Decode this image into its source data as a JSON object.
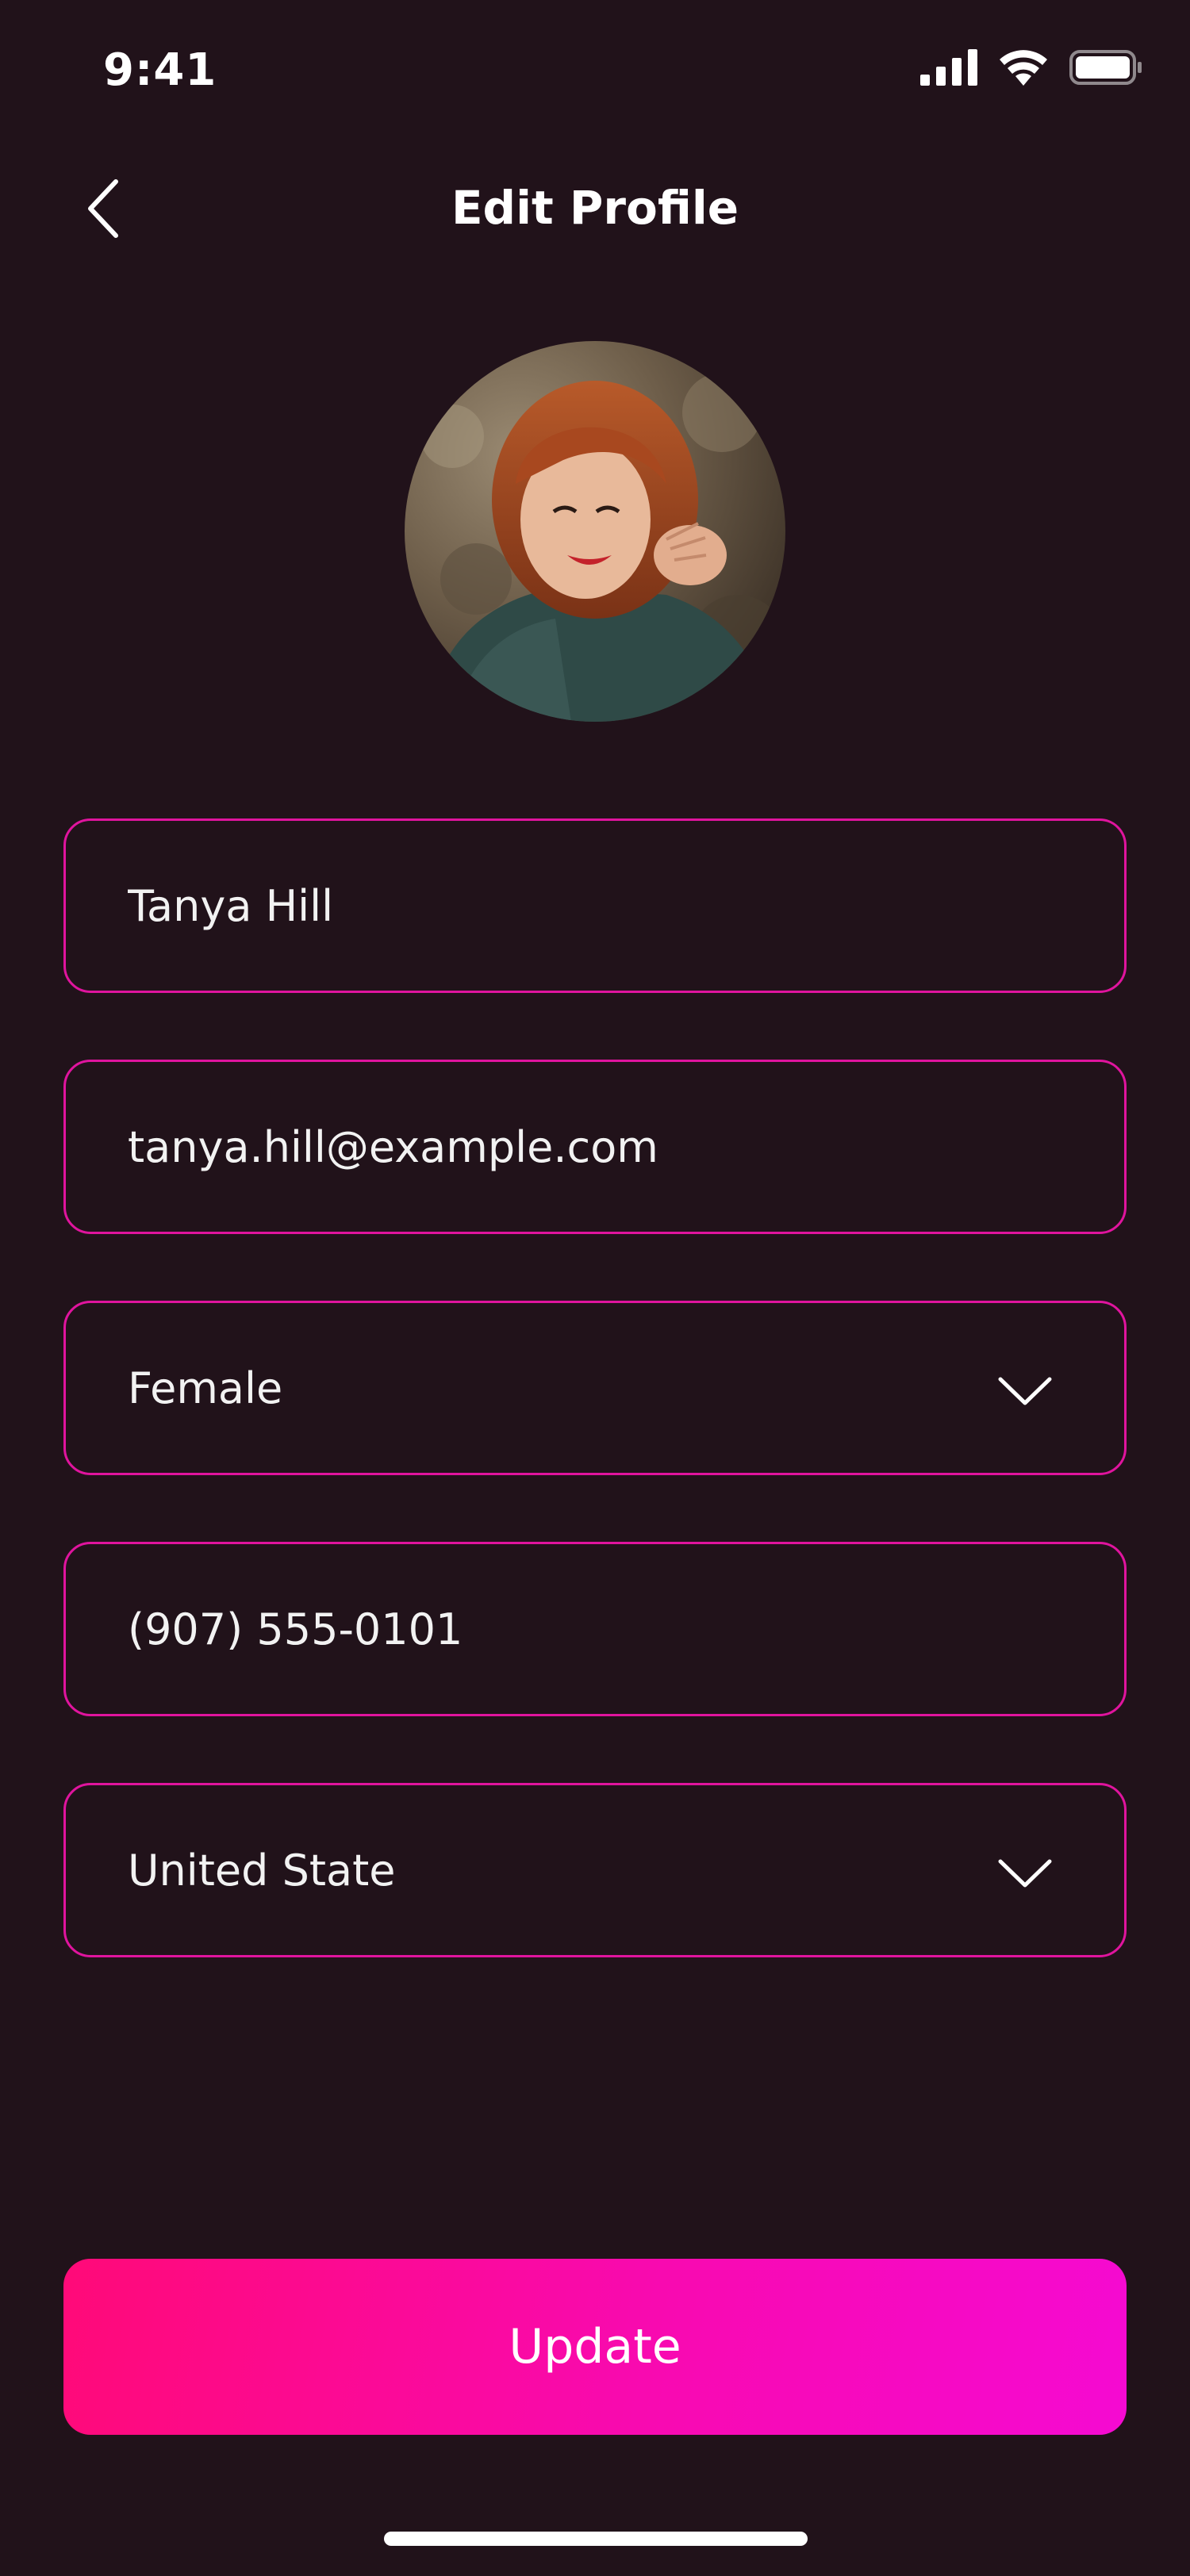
{
  "status_bar": {
    "time": "9:41",
    "icons": [
      "cellular-signal-icon",
      "wifi-icon",
      "battery-icon"
    ]
  },
  "header": {
    "back_icon": "chevron-left-icon",
    "title": "Edit Profile"
  },
  "avatar": {
    "description_icon": "profile-photo"
  },
  "form": {
    "name": {
      "value": "Tanya Hill"
    },
    "email": {
      "value": "tanya.hill@example.com"
    },
    "gender": {
      "value": "Female",
      "icon": "chevron-down-icon"
    },
    "phone": {
      "value": "(907) 555-0101"
    },
    "country": {
      "value": "United State",
      "icon": "chevron-down-icon"
    }
  },
  "actions": {
    "update_label": "Update"
  },
  "colors": {
    "background": "#21121a",
    "field_border": "#e0149e",
    "button_gradient_start": "#ff0a78",
    "button_gradient_end": "#f50ad2",
    "text": "#ffffff"
  }
}
